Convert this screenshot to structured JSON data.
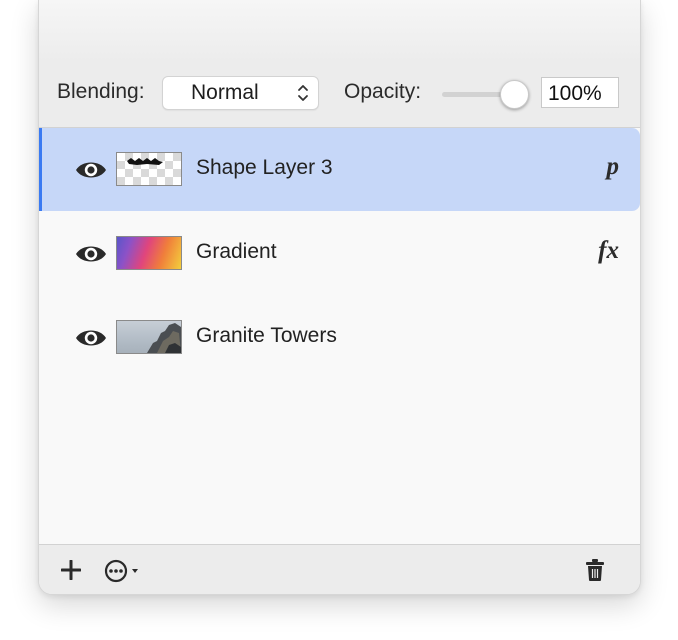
{
  "controls": {
    "blending_label": "Blending:",
    "blending_value": "Normal",
    "opacity_label": "Opacity:",
    "opacity_value": "100%",
    "opacity_fraction": 1.0
  },
  "layers": [
    {
      "name": "Shape Layer 3",
      "badge": "p",
      "thumbnail": "shape-text-on-transparent",
      "visible": true,
      "selected": true
    },
    {
      "name": "Gradient",
      "badge": "fx",
      "thumbnail": "color-gradient",
      "visible": true,
      "selected": false
    },
    {
      "name": "Granite Towers",
      "badge": "",
      "thumbnail": "rock-photo",
      "visible": true,
      "selected": false
    }
  ],
  "footer": {
    "icons": [
      "plus-icon",
      "more-options-icon",
      "trash-icon"
    ]
  },
  "colors": {
    "selection": "#c6d7f8",
    "selection_edge": "#3a7af2",
    "panel_bg": "#f9f9f9",
    "toolbar_bg": "#ececec"
  }
}
